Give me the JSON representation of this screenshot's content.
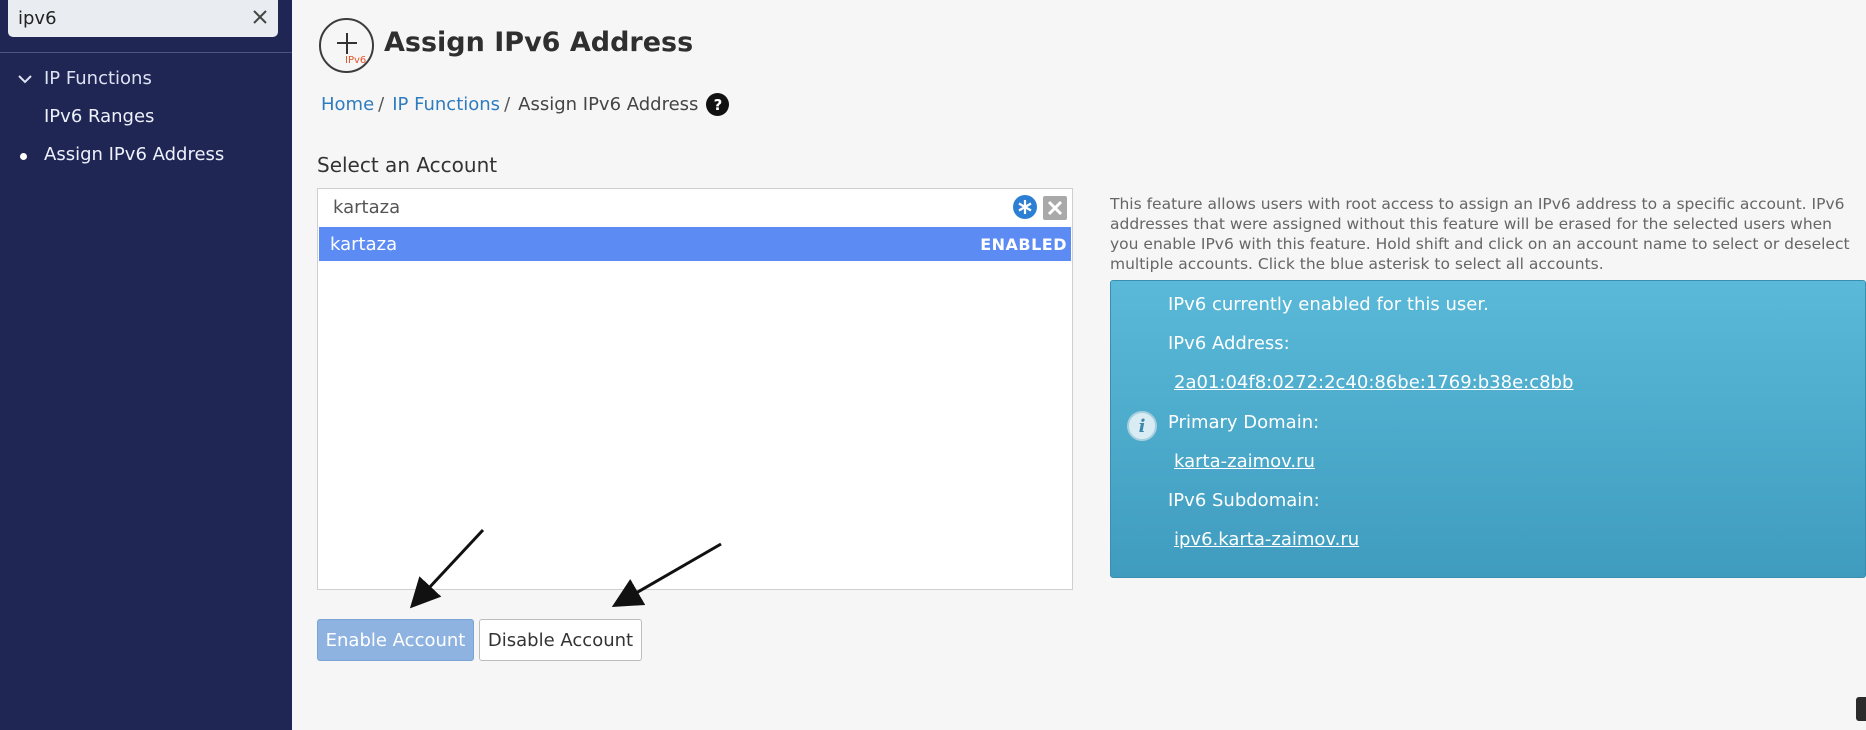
{
  "sidebar": {
    "search_value": "ipv6",
    "group_label": "IP Functions",
    "items": [
      {
        "label": "IPv6 Ranges"
      },
      {
        "label": "Assign IPv6 Address"
      }
    ]
  },
  "header": {
    "icon_badge": "IPv6",
    "title": "Assign IPv6 Address"
  },
  "breadcrumb": {
    "home": "Home",
    "section": "IP Functions",
    "current": "Assign IPv6 Address",
    "separator": "/",
    "help_glyph": "?"
  },
  "account_select": {
    "label": "Select an Account",
    "filter_value": "kartaza",
    "rows": [
      {
        "name": "kartaza",
        "status": "ENABLED"
      }
    ]
  },
  "buttons": {
    "enable": "Enable Account",
    "disable": "Disable Account"
  },
  "feature_description": "This feature allows users with root access to assign an IPv6 address to a specific account. IPv6 addresses that were assigned without this feature will be erased for the selected users when you enable IPv6 with this feature. Hold shift and click on an account name to select or deselect multiple accounts. Click the blue asterisk to select all accounts.",
  "info_panel": {
    "status": "IPv6 currently enabled for this user.",
    "address_label": "IPv6 Address:",
    "address_value": "2a01:04f8:0272:2c40:86be:1769:b38e:c8bb",
    "domain_label": "Primary Domain:",
    "domain_value": "karta-zaimov.ru",
    "subdomain_label": "IPv6 Subdomain:",
    "subdomain_value": "ipv6.karta-zaimov.ru",
    "icon_glyph": "i"
  },
  "colors": {
    "sidebar_bg": "#1f2654",
    "selected_row": "#5d8bf4",
    "link": "#2f7bbf",
    "info_panel": "#4aaad0",
    "enable_button": "#8eb3e0"
  },
  "icons": [
    "close-icon",
    "chevron-down-icon",
    "plus-icon",
    "help-icon",
    "asterisk-icon",
    "info-icon"
  ]
}
